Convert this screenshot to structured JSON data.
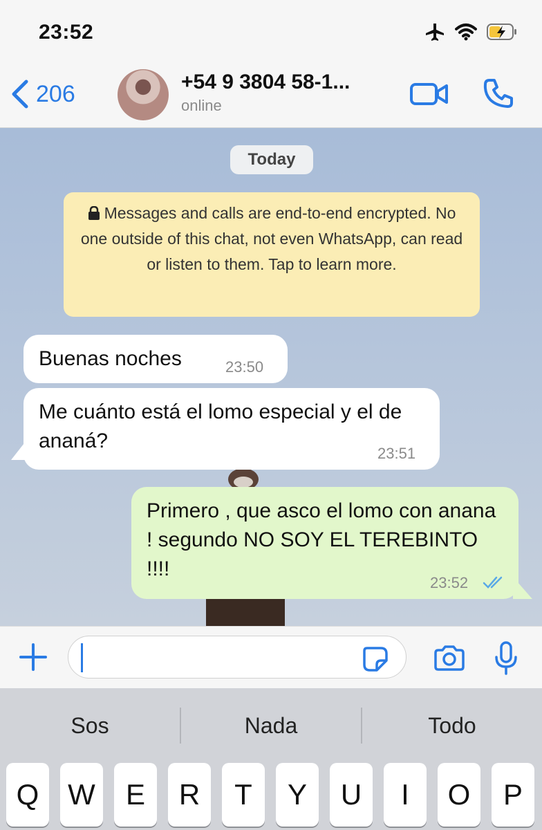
{
  "status_bar": {
    "time": "23:52"
  },
  "header": {
    "back_count": "206",
    "contact_name": "+54 9 3804 58-1...",
    "contact_status": "online"
  },
  "chat": {
    "date_label": "Today",
    "encryption_notice": "Messages and calls are end-to-end encrypted. No one outside of this chat, not even WhatsApp, can read or listen to them. Tap to learn more.",
    "messages": [
      {
        "direction": "incoming",
        "text": "Buenas noches",
        "time": "23:50"
      },
      {
        "direction": "incoming",
        "text": "Me cuánto está el lomo especial y el de ananá?",
        "time": "23:51"
      },
      {
        "direction": "outgoing",
        "text": "Primero , que asco el lomo con anana ! segundo  NO SOY EL TEREBINTO !!!!",
        "time": "23:52",
        "status": "read"
      }
    ]
  },
  "input": {
    "value": ""
  },
  "keyboard": {
    "suggestions": [
      "Sos",
      "Nada",
      "Todo"
    ],
    "row1": [
      "Q",
      "W",
      "E",
      "R",
      "T",
      "Y",
      "U",
      "I",
      "O",
      "P"
    ]
  },
  "colors": {
    "accent": "#2a7be4",
    "outgoing_bubble": "#e2f7cb",
    "incoming_bubble": "#ffffff",
    "encryption_notice_bg": "#fbedb5",
    "read_ticks": "#5aa9e6"
  },
  "icons": {
    "status": [
      "airplane-icon",
      "wifi-icon",
      "battery-charging-icon"
    ],
    "header": [
      "chevron-left-icon",
      "video-camera-icon",
      "phone-icon"
    ],
    "input": [
      "plus-icon",
      "sticker-icon",
      "camera-icon",
      "microphone-icon"
    ]
  }
}
